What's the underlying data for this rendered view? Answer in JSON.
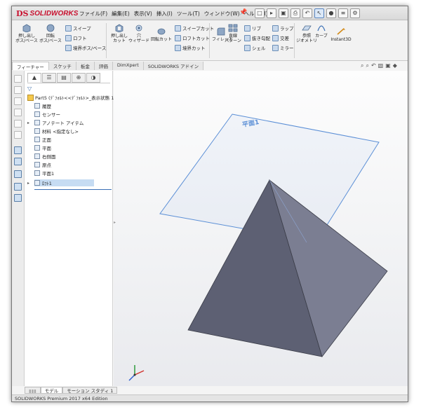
{
  "app": {
    "logo_ds": "DS",
    "logo_name": "SOLIDWORKS"
  },
  "menu": [
    "ファイル(F)",
    "編集(E)",
    "表示(V)",
    "挿入(I)",
    "ツール(T)",
    "ウィンドウ(W)",
    "ヘルプ(H)"
  ],
  "ribbon": {
    "extruded_boss": "押し出し\nボス/ベース",
    "revolved_boss": "回転\nボス/ベース",
    "swept_boss": "スイープ",
    "loft": "ロフト",
    "boundary_boss": "境界ボス/ベース",
    "extruded_cut": "押し出し\nカット",
    "hole_wizard": "穴\nウィザード",
    "revolved_cut": "回転カット",
    "swept_cut": "スイープカット",
    "lofted_cut": "ロフトカット",
    "boundary_cut": "境界カット",
    "fillet": "フィレット",
    "linear_pattern": "直線\nパターン",
    "rib": "リブ",
    "draft": "抜き勾配",
    "shell": "シェル",
    "wrap": "ラップ",
    "intersect": "交差",
    "mirror": "ミラー",
    "reference_geometry": "参照\nジオメトリ",
    "curves": "カーブ",
    "instant3d": "Instant3D"
  },
  "command_tabs": [
    "フィーチャー",
    "スケッチ",
    "板金",
    "評価",
    "DimXpert",
    "SOLIDWORKS アドイン"
  ],
  "feature_tree": {
    "root": "Part5 (ﾃﾞﾌｫﾙﾄ<<ﾃﾞﾌｫﾙﾄ>_表示状態 1>)",
    "items": [
      "履歴",
      "センサー",
      "アノテート アイテム",
      "材料 <指定なし>",
      "正面",
      "平面",
      "右側面",
      "原点",
      "平面1",
      "ﾛﾌﾄ1"
    ]
  },
  "viewport": {
    "plane_label": "平面1"
  },
  "bottom_tabs": [
    "モデル",
    "モーション スタディ 1"
  ],
  "status": "SOLIDWORKS Premium 2017 x64 Edition",
  "colors": {
    "brand_red": "#c8102e",
    "plane_blue": "#5b8fd6",
    "pyramid_dark": "#5d6073",
    "pyramid_light": "#7b7e92"
  },
  "icons": [
    "pin-icon",
    "new-document-icon",
    "open-icon",
    "save-icon",
    "print-icon",
    "undo-icon",
    "select-icon",
    "rebuild-icon",
    "options-icon",
    "filter-icon",
    "axis-triad-icon"
  ]
}
